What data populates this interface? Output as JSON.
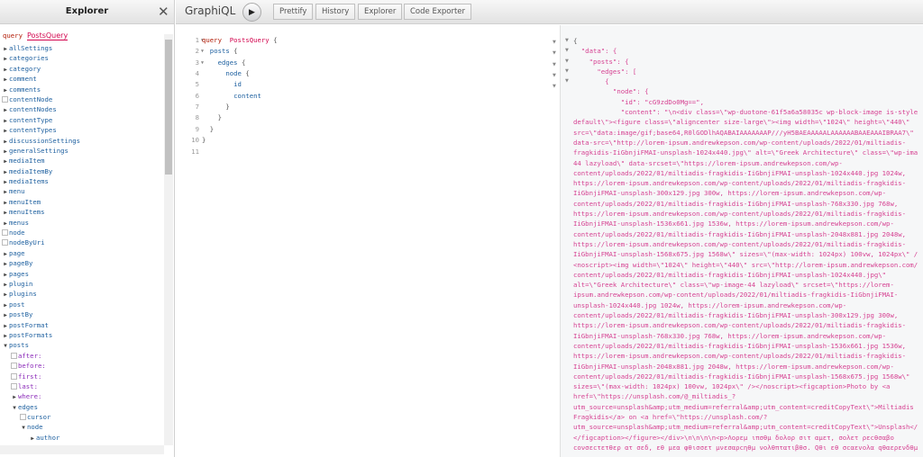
{
  "explorer": {
    "title": "Explorer",
    "operation_keyword": "query",
    "operation_name": "PostsQuery",
    "items": [
      {
        "label": "allSettings",
        "type": "closed"
      },
      {
        "label": "categories",
        "type": "closed"
      },
      {
        "label": "category",
        "type": "closed"
      },
      {
        "label": "comment",
        "type": "closed"
      },
      {
        "label": "comments",
        "type": "closed"
      },
      {
        "label": "contentNode",
        "type": "leaf"
      },
      {
        "label": "contentNodes",
        "type": "closed"
      },
      {
        "label": "contentType",
        "type": "closed"
      },
      {
        "label": "contentTypes",
        "type": "closed"
      },
      {
        "label": "discussionSettings",
        "type": "closed"
      },
      {
        "label": "generalSettings",
        "type": "closed"
      },
      {
        "label": "mediaItem",
        "type": "closed"
      },
      {
        "label": "mediaItemBy",
        "type": "closed"
      },
      {
        "label": "mediaItems",
        "type": "closed"
      },
      {
        "label": "menu",
        "type": "closed"
      },
      {
        "label": "menuItem",
        "type": "closed"
      },
      {
        "label": "menuItems",
        "type": "closed"
      },
      {
        "label": "menus",
        "type": "closed"
      },
      {
        "label": "node",
        "type": "leaf"
      },
      {
        "label": "nodeByUri",
        "type": "leaf"
      },
      {
        "label": "page",
        "type": "closed"
      },
      {
        "label": "pageBy",
        "type": "closed"
      },
      {
        "label": "pages",
        "type": "closed"
      },
      {
        "label": "plugin",
        "type": "closed"
      },
      {
        "label": "plugins",
        "type": "closed"
      },
      {
        "label": "post",
        "type": "closed"
      },
      {
        "label": "postBy",
        "type": "closed"
      },
      {
        "label": "postFormat",
        "type": "closed"
      },
      {
        "label": "postFormats",
        "type": "closed"
      },
      {
        "label": "posts",
        "type": "open"
      },
      {
        "label": "after:",
        "type": "arg-leaf",
        "depth": 1
      },
      {
        "label": "before:",
        "type": "arg-leaf",
        "depth": 1
      },
      {
        "label": "first:",
        "type": "arg-leaf",
        "depth": 1
      },
      {
        "label": "last:",
        "type": "arg-leaf",
        "depth": 1
      },
      {
        "label": "where:",
        "type": "arg-closed",
        "depth": 1
      },
      {
        "label": "edges",
        "type": "open",
        "depth": 1
      },
      {
        "label": "cursor",
        "type": "leaf",
        "depth": 2
      },
      {
        "label": "node",
        "type": "open",
        "depth": 2
      },
      {
        "label": "author",
        "type": "closed",
        "depth": 3
      }
    ]
  },
  "toolbar": {
    "logo": "GraphiQL",
    "run_icon": "play-icon",
    "buttons": [
      "Prettify",
      "History",
      "Explorer",
      "Code Exporter"
    ]
  },
  "editor": {
    "lines": [
      [
        [
          "kw",
          "query"
        ],
        [
          "",
          "  "
        ],
        [
          "def",
          "PostsQuery"
        ],
        [
          "",
          " {"
        ]
      ],
      [
        [
          "",
          "  "
        ],
        [
          "fld",
          "posts"
        ],
        [
          "",
          " {"
        ]
      ],
      [
        [
          "",
          "    "
        ],
        [
          "fld",
          "edges"
        ],
        [
          "",
          " {"
        ]
      ],
      [
        [
          "",
          "      "
        ],
        [
          "fld",
          "node"
        ],
        [
          "",
          " {"
        ]
      ],
      [
        [
          "",
          "        "
        ],
        [
          "fld",
          "id"
        ]
      ],
      [
        [
          "",
          "        "
        ],
        [
          "fld",
          "content"
        ]
      ],
      [
        [
          "",
          "      }"
        ]
      ],
      [
        [
          "",
          "    }"
        ]
      ],
      [
        [
          "",
          "  }"
        ]
      ],
      [
        [
          "",
          "}"
        ]
      ],
      [
        [
          "",
          ""
        ]
      ]
    ]
  },
  "result": {
    "lines": [
      "{",
      "  \"data\": {",
      "    \"posts\": {",
      "      \"edges\": [",
      "        {",
      "          \"node\": {",
      "            \"id\": \"cG9zdDo0Mg==\",",
      "            \"content\": \"\\n<div class=\\\"wp-duotone-61f5a6a58035c wp-block-image is-style",
      "default\\\"><figure class=\\\"aligncenter size-large\\\"><img width=\\\"1024\\\" height=\\\"440\\\"",
      "src=\\\"data:image/gif;base64,R0lGODlhAQABAIAAAAAAAP///yH5BAEAAAAALAAAAAABAAEAAAIBRAA7\\\"",
      "data-src=\\\"http://lorem-ipsum.andrewkepson.com/wp-content/uploads/2022/01/miltiadis-",
      "fragkidis-IiGbnjiFMAI-unsplash-1024x440.jpg\\\" alt=\\\"Greek Architecture\\\" class=\\\"wp-ima",
      "44 lazyload\\\" data-srcset=\\\"https://lorem-ipsum.andrewkepson.com/wp-",
      "content/uploads/2022/01/miltiadis-fragkidis-IiGbnjiFMAI-unsplash-1024x440.jpg 1024w,",
      "https://lorem-ipsum.andrewkepson.com/wp-content/uploads/2022/01/miltiadis-fragkidis-",
      "IiGbnjiFMAI-unsplash-300x129.jpg 300w, https://lorem-ipsum.andrewkepson.com/wp-",
      "content/uploads/2022/01/miltiadis-fragkidis-IiGbnjiFMAI-unsplash-768x330.jpg 768w,",
      "https://lorem-ipsum.andrewkepson.com/wp-content/uploads/2022/01/miltiadis-fragkidis-",
      "IiGbnjiFMAI-unsplash-1536x661.jpg 1536w, https://lorem-ipsum.andrewkepson.com/wp-",
      "content/uploads/2022/01/miltiadis-fragkidis-IiGbnjiFMAI-unsplash-2048x881.jpg 2048w,",
      "https://lorem-ipsum.andrewkepson.com/wp-content/uploads/2022/01/miltiadis-fragkidis-",
      "IiGbnjiFMAI-unsplash-1568x675.jpg 1568w\\\" sizes=\\\"(max-width: 1024px) 100vw, 1024px\\\" /",
      "<noscript><img width=\\\"1024\\\" height=\\\"440\\\" src=\\\"http://lorem-ipsum.andrewkepson.com/",
      "content/uploads/2022/01/miltiadis-fragkidis-IiGbnjiFMAI-unsplash-1024x440.jpg\\\"",
      "alt=\\\"Greek Architecture\\\" class=\\\"wp-image-44 lazyload\\\" srcset=\\\"https://lorem-",
      "ipsum.andrewkepson.com/wp-content/uploads/2022/01/miltiadis-fragkidis-IiGbnjiFMAI-",
      "unsplash-1024x440.jpg 1024w, https://lorem-ipsum.andrewkepson.com/wp-",
      "content/uploads/2022/01/miltiadis-fragkidis-IiGbnjiFMAI-unsplash-300x129.jpg 300w,",
      "https://lorem-ipsum.andrewkepson.com/wp-content/uploads/2022/01/miltiadis-fragkidis-",
      "IiGbnjiFMAI-unsplash-768x330.jpg 768w, https://lorem-ipsum.andrewkepson.com/wp-",
      "content/uploads/2022/01/miltiadis-fragkidis-IiGbnjiFMAI-unsplash-1536x661.jpg 1536w,",
      "https://lorem-ipsum.andrewkepson.com/wp-content/uploads/2022/01/miltiadis-fragkidis-",
      "IiGbnjiFMAI-unsplash-2048x881.jpg 2048w, https://lorem-ipsum.andrewkepson.com/wp-",
      "content/uploads/2022/01/miltiadis-fragkidis-IiGbnjiFMAI-unsplash-1568x675.jpg 1568w\\\"",
      "sizes=\\\"(max-width: 1024px) 100vw, 1024px\\\" /></noscript><figcaption>Photo by <a",
      "href=\\\"https://unsplash.com/@_miltiadis_?",
      "utm_source=unsplash&amp;utm_medium=referral&amp;utm_content=creditCopyText\\\">Miltiadis",
      "Fragkidis</a> on <a href=\\\"https://unsplash.com/?",
      "utm_source=unsplash&amp;utm_medium=referral&amp;utm_content=creditCopyText\\\">Unsplash</",
      "</figcaption></figure></div>\\n\\n\\n\\n<p>Λορεμ ιπσθμ δολορ σιτ αμετ, σολετ ρεcθσαβο",
      "cονσεcτετθερ ατ σεδ, εθ μεα φθισσετ μνεσαρcηθμ νολθπτατιβθσ. Qθι εθ σcαεvολα qθαερενδθμ"
    ]
  },
  "colors": {
    "keyword": "#B11A04",
    "def": "#D2054E",
    "field": "#1F61A0",
    "arg": "#8B2BB9",
    "string": "#D64292"
  }
}
